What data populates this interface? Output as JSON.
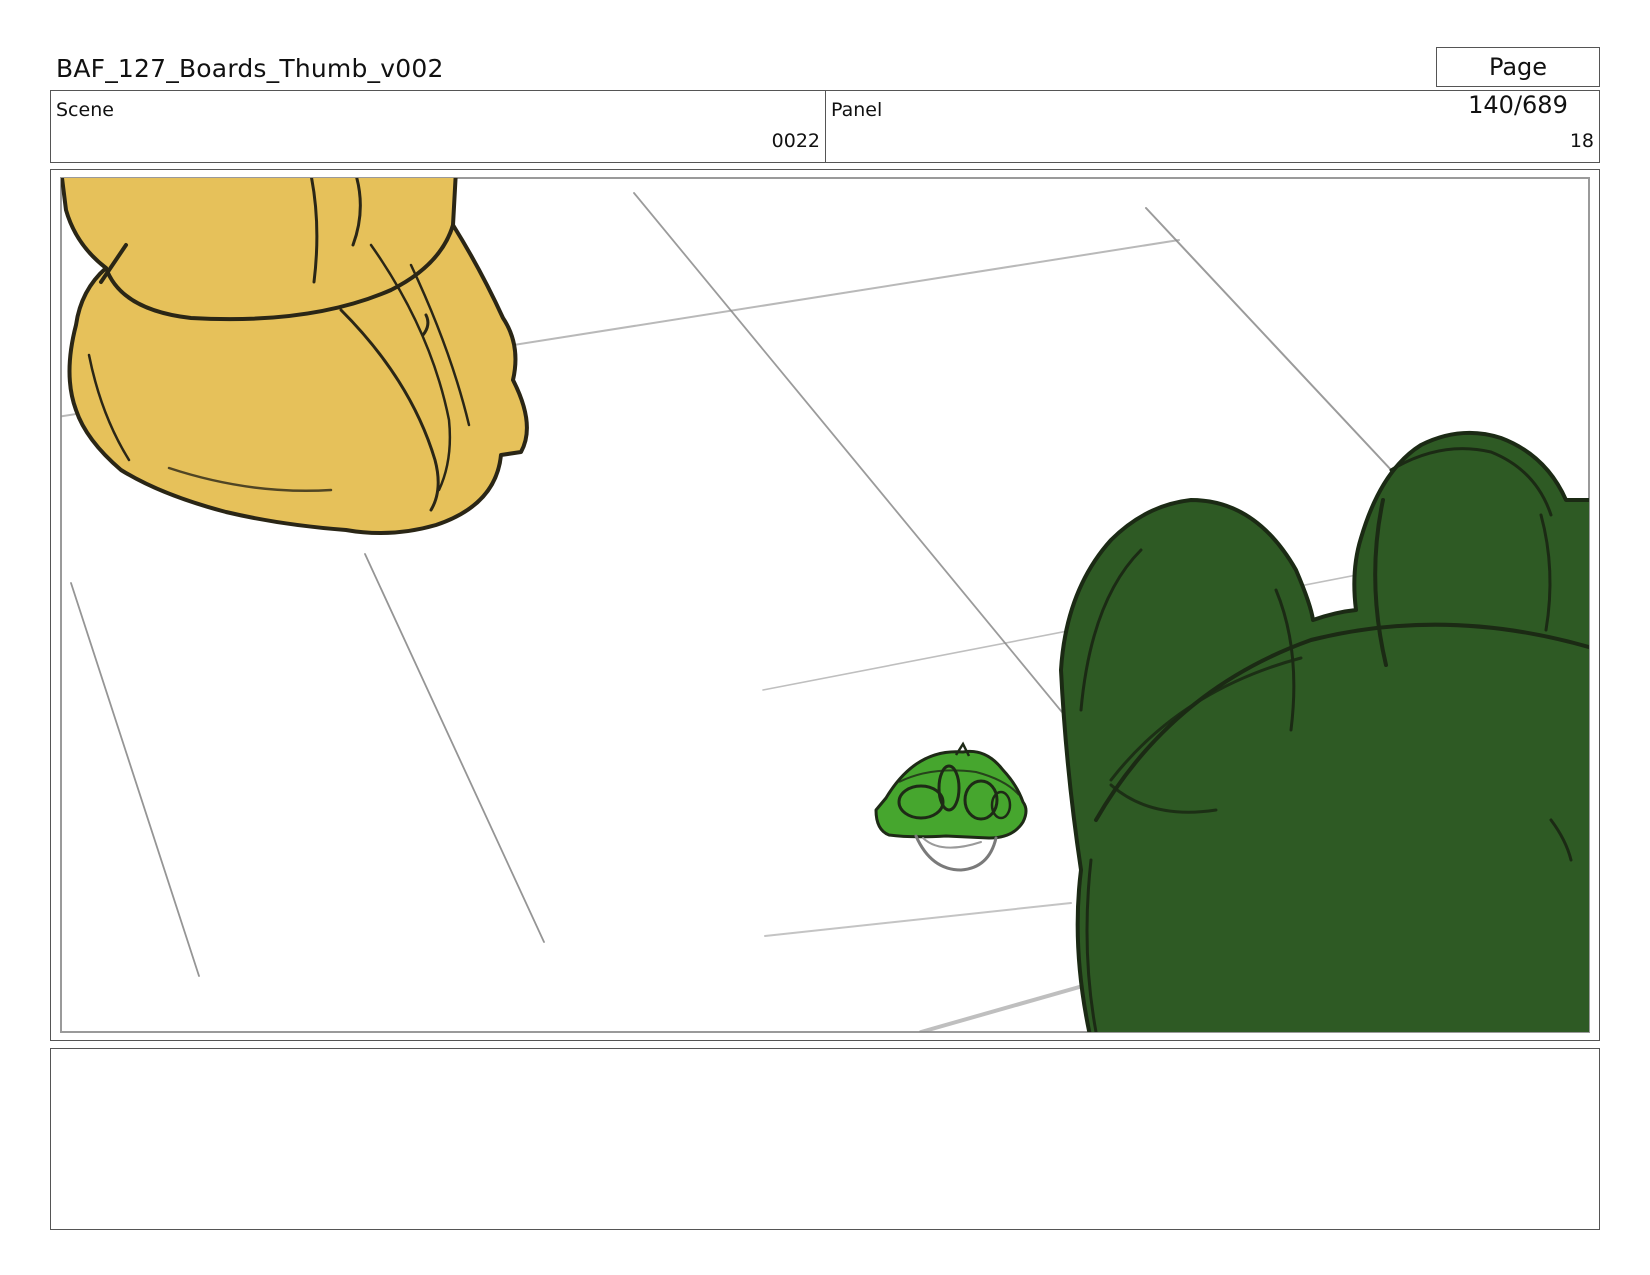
{
  "header": {
    "document_title": "BAF_127_Boards_Thumb_v002",
    "page_label": "Page 140/689"
  },
  "info": {
    "scene_label": "Scene",
    "scene_value": "0022",
    "panel_label": "Panel",
    "panel_value": "18"
  },
  "colors": {
    "yellow_character": "#e6c15a",
    "large_green_character": "#2e5a24",
    "small_green_character": "#46a62e",
    "sketch_line": "#8a8a8a",
    "outline": "#1e1e16"
  }
}
